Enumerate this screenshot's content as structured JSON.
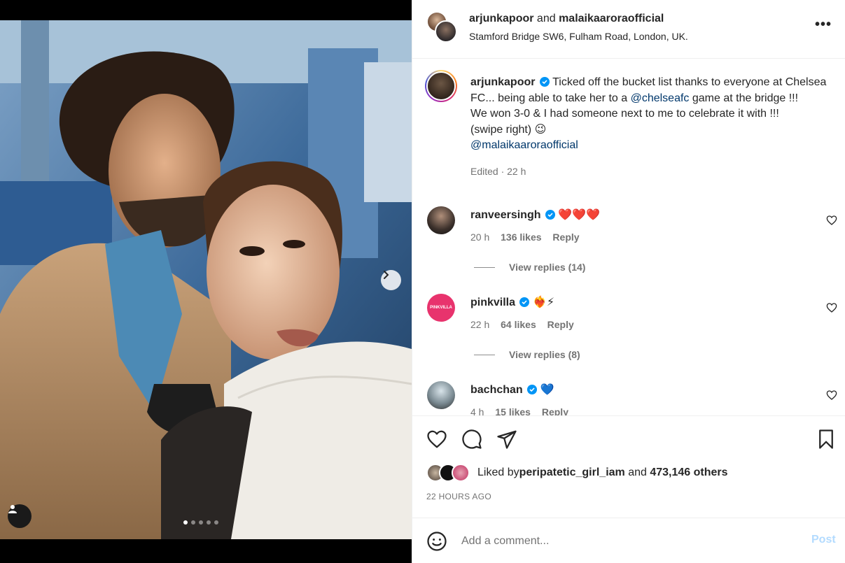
{
  "header": {
    "user1": "arjunkapoor",
    "and_text": " and ",
    "user2": "malaikaaroraofficial",
    "location": "Stamford Bridge SW6, Fulham Road, London, UK.",
    "more_label": "•••"
  },
  "caption": {
    "username": "arjunkapoor",
    "text_part1": "Ticked off the bucket list thanks to everyone at Chelsea FC... being able to take her to a ",
    "mention1": "@chelseafc",
    "text_part2": " game at the bridge !!!",
    "line2": "We won 3-0 & I had someone next to me to celebrate it with !!!",
    "line3": "(swipe right) 😉",
    "mention2": "@malaikaaroraofficial",
    "edited": "Edited · 22 h"
  },
  "comments": [
    {
      "username": "ranveersingh",
      "text": "❤️❤️❤️",
      "time": "20 h",
      "likes": "136 likes",
      "reply": "Reply",
      "view_replies": "View replies (14)"
    },
    {
      "username": "pinkvilla",
      "text": "❤️‍🔥⚡",
      "time": "22 h",
      "likes": "64 likes",
      "reply": "Reply",
      "view_replies": "View replies (8)",
      "avatar_text": "PINKVILLA"
    },
    {
      "username": "bachchan",
      "text": "💙",
      "time": "4 h",
      "likes": "15 likes",
      "reply": "Reply"
    }
  ],
  "likes": {
    "prefix": "Liked by ",
    "user": "peripatetic_girl_iam",
    "middle": " and ",
    "count": "473,146 others"
  },
  "time_ago": "22 HOURS AGO",
  "comment_bar": {
    "placeholder": "Add a comment...",
    "post_label": "Post"
  },
  "carousel": {
    "total": 5,
    "active": 1
  },
  "colors": {
    "accent": "#0095f6",
    "mention": "#00376b",
    "post_disabled": "#b3dbff",
    "heart": "#ff3040"
  }
}
